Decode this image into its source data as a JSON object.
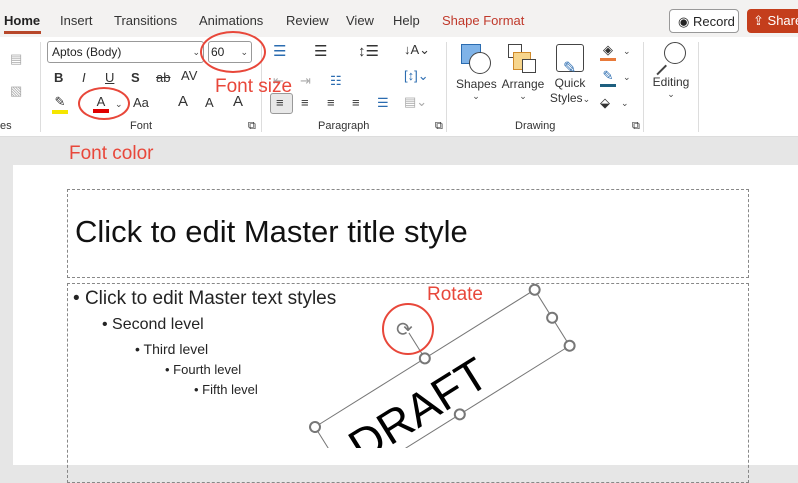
{
  "tabs": [
    "Home",
    "Insert",
    "Transitions",
    "Animations",
    "Review",
    "View",
    "Help",
    "Shape Format"
  ],
  "record_label": "Record",
  "share_label": "Share",
  "font": {
    "name": "Aptos (Body)",
    "size": "60",
    "group_label": "Font",
    "bold": "B",
    "italic": "I",
    "underline": "U",
    "shadow": "S",
    "strike": "ab",
    "spacing": "AV",
    "color_letter": "A",
    "case": "Aa",
    "grow": "A",
    "shrink": "A",
    "highlight_color": "#f5e600",
    "font_color": "#e00000"
  },
  "paragraph": {
    "group_label": "Paragraph"
  },
  "drawing": {
    "group_label": "Drawing",
    "shapes": "Shapes",
    "arrange": "Arrange",
    "quick_styles_1": "Quick",
    "quick_styles_2": "Styles"
  },
  "editing": {
    "label": "Editing"
  },
  "left_group_label": "es",
  "annotations": {
    "font_size": "Font size",
    "font_color": "Font color",
    "rotate": "Rotate"
  },
  "slide": {
    "title": "Click to edit Master title style",
    "levels": [
      "Click to edit Master text styles",
      "Second level",
      "Third level",
      "Fourth level",
      "Fifth level"
    ],
    "shape_text": "DRAFT"
  }
}
